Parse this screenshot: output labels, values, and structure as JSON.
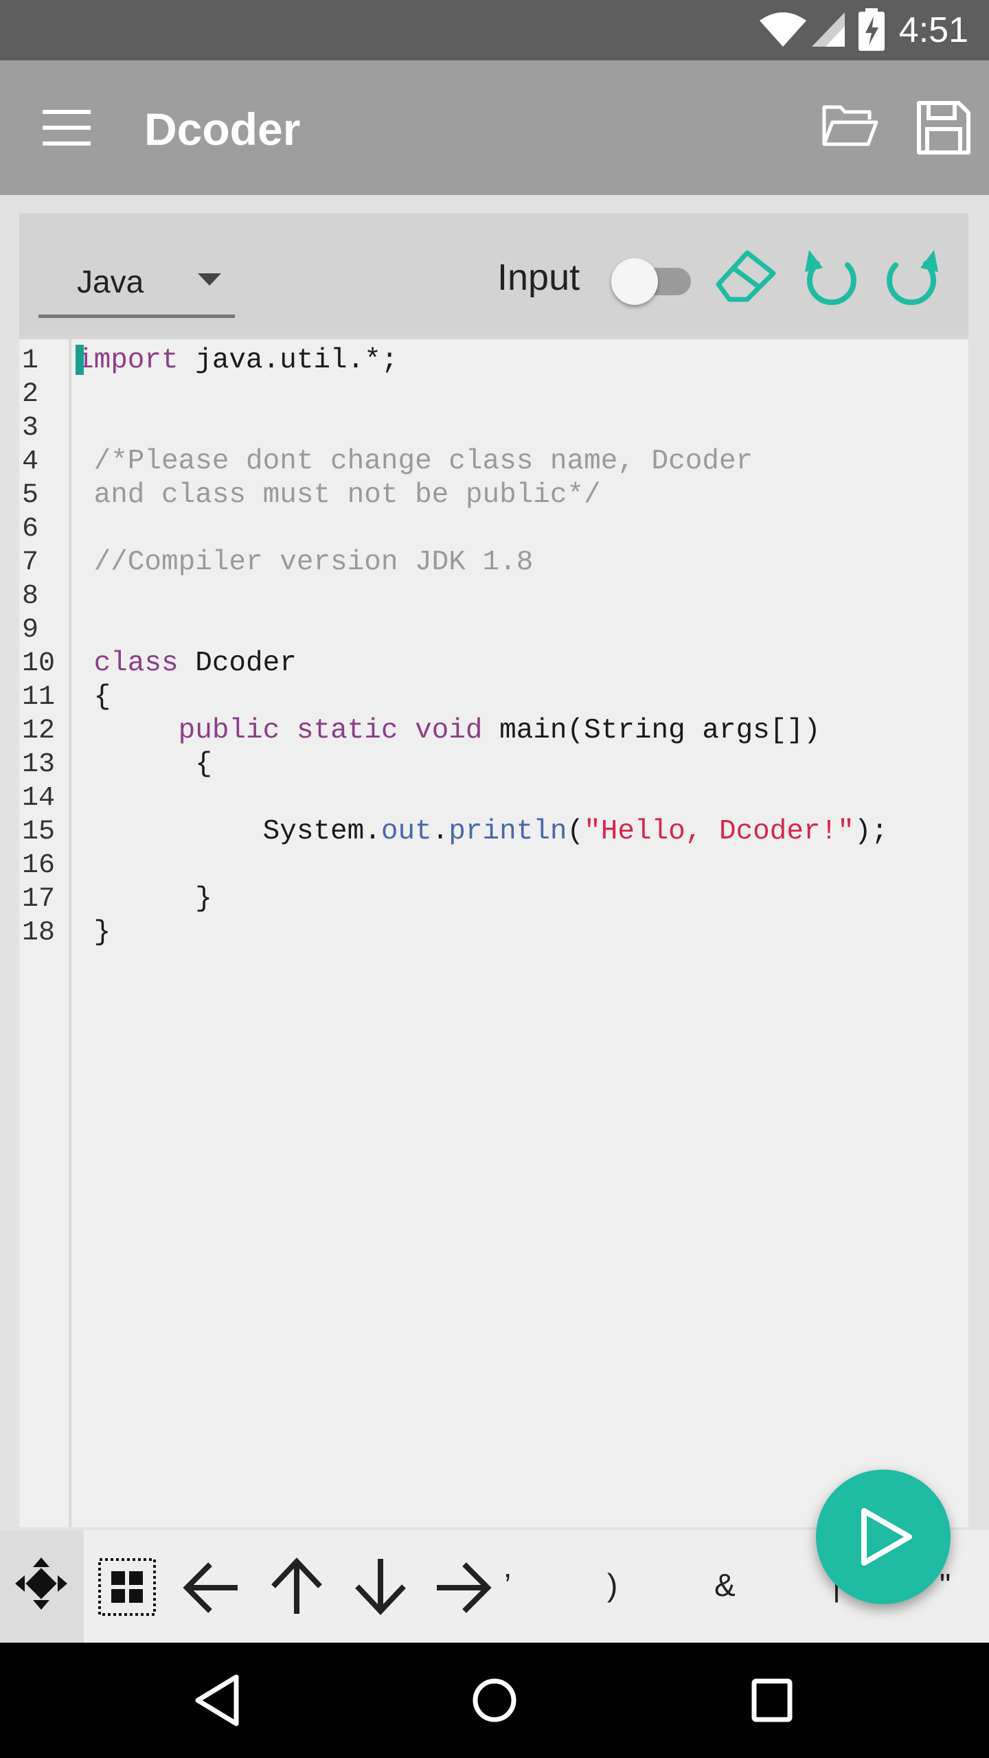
{
  "status_bar": {
    "time": "4:51"
  },
  "app_bar": {
    "title": "Dcoder"
  },
  "toolbar": {
    "language": "Java",
    "input_label": "Input",
    "input_enabled": false
  },
  "editor": {
    "line_numbers": [
      "1",
      "2",
      "3",
      "4",
      "5",
      "6",
      "7",
      "8",
      "9",
      "10",
      "11",
      "12",
      "13",
      "14",
      "15",
      "16",
      "17",
      "18"
    ],
    "lines": [
      [
        {
          "t": "import",
          "c": "kw"
        },
        {
          "t": " java.util.*;",
          "c": ""
        }
      ],
      [],
      [],
      [
        {
          "t": " /*Please dont change class name, Dcoder",
          "c": "cm"
        }
      ],
      [
        {
          "t": " and class must not be public*/",
          "c": "cm"
        }
      ],
      [],
      [
        {
          "t": " //Compiler version JDK 1.8",
          "c": "cm"
        }
      ],
      [],
      [],
      [
        {
          "t": " class",
          "c": "kw"
        },
        {
          "t": " Dcoder",
          "c": ""
        }
      ],
      [
        {
          "t": " {",
          "c": ""
        }
      ],
      [
        {
          "t": "      public",
          "c": "kw"
        },
        {
          "t": " ",
          "c": ""
        },
        {
          "t": "static",
          "c": "kw"
        },
        {
          "t": " ",
          "c": ""
        },
        {
          "t": "void",
          "c": "kw"
        },
        {
          "t": " main(String args[])",
          "c": ""
        }
      ],
      [
        {
          "t": "       {",
          "c": ""
        }
      ],
      [],
      [
        {
          "t": "           System.",
          "c": ""
        },
        {
          "t": "out",
          "c": "fld"
        },
        {
          "t": ".",
          "c": ""
        },
        {
          "t": "println",
          "c": "fld"
        },
        {
          "t": "(",
          "c": ""
        },
        {
          "t": "\"Hello, Dcoder!\"",
          "c": "str"
        },
        {
          "t": ");",
          "c": ""
        }
      ],
      [],
      [
        {
          "t": "       }",
          "c": ""
        }
      ],
      [
        {
          "t": " }",
          "c": ""
        }
      ]
    ]
  },
  "key_row": {
    "symbols": [
      "’",
      ")",
      "&",
      "|",
      "\""
    ]
  },
  "colors": {
    "accent": "#1fbba3",
    "keyword": "#8b3f87",
    "comment": "#9a9a9a",
    "field": "#4a68a8",
    "string": "#d8254d"
  }
}
